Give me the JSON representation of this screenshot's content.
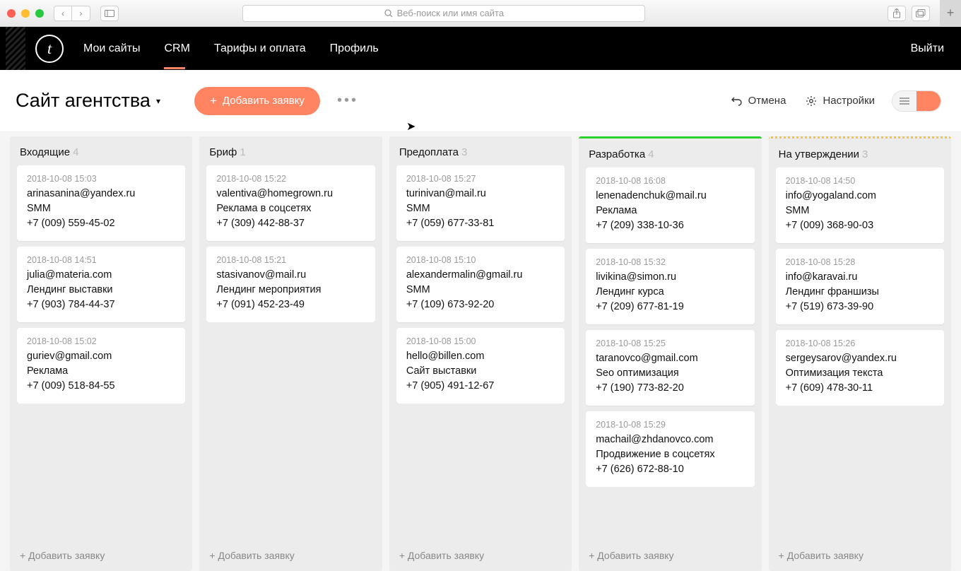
{
  "chrome": {
    "placeholder": "Веб-поиск или имя сайта"
  },
  "nav": {
    "logo": "t",
    "mySites": "Мои сайты",
    "crm": "CRM",
    "pricing": "Тарифы и оплата",
    "profile": "Профиль",
    "logout": "Выйти"
  },
  "toolbar": {
    "pageTitle": "Сайт агентства",
    "addLead": "Добавить заявку",
    "cancel": "Отмена",
    "settings": "Настройки"
  },
  "board": {
    "addCard": "+ Добавить заявку",
    "columns": [
      {
        "title": "Входящие",
        "count": "4",
        "accent": "none",
        "cards": [
          {
            "date": "2018-10-08 15:03",
            "email": "arinasanina@yandex.ru",
            "topic": "SMM",
            "phone": "+7 (009) 559-45-02"
          },
          {
            "date": "2018-10-08 14:51",
            "email": "julia@materia.com",
            "topic": "Лендинг выставки",
            "phone": "+7 (903) 784-44-37"
          },
          {
            "date": "2018-10-08 15:02",
            "email": "guriev@gmail.com",
            "topic": "Реклама",
            "phone": "+7 (009) 518-84-55"
          }
        ]
      },
      {
        "title": "Бриф",
        "count": "1",
        "accent": "none",
        "cards": [
          {
            "date": "2018-10-08 15:22",
            "email": "valentiva@homegrown.ru",
            "topic": "Реклама в соцсетях",
            "phone": "+7 (309) 442-88-37"
          },
          {
            "date": "2018-10-08 15:21",
            "email": "stasivanov@mail.ru",
            "topic": "Лендинг мероприятия",
            "phone": "+7 (091) 452-23-49"
          }
        ]
      },
      {
        "title": "Предоплата",
        "count": "3",
        "accent": "none",
        "cards": [
          {
            "date": "2018-10-08 15:27",
            "email": "turinivan@mail.ru",
            "topic": "SMM",
            "phone": "+7 (059) 677-33-81"
          },
          {
            "date": "2018-10-08 15:10",
            "email": "alexandermalin@gmail.ru",
            "topic": "SMM",
            "phone": "+7 (109) 673-92-20"
          },
          {
            "date": "2018-10-08 15:00",
            "email": "hello@billen.com",
            "topic": "Сайт выставки",
            "phone": "+7 (905) 491-12-67"
          }
        ]
      },
      {
        "title": "Разработка",
        "count": "4",
        "accent": "green",
        "cards": [
          {
            "date": "2018-10-08 16:08",
            "email": "lenenadenchuk@mail.ru",
            "topic": "Реклама",
            "phone": "+7 (209) 338-10-36"
          },
          {
            "date": "2018-10-08 15:32",
            "email": "livikina@simon.ru",
            "topic": "Лендинг курса",
            "phone": "+7 (209) 677-81-19"
          },
          {
            "date": "2018-10-08 15:25",
            "email": "taranovco@gmail.com",
            "topic": "Seo оптимизация",
            "phone": "+7 (190) 773-82-20"
          },
          {
            "date": "2018-10-08 15:29",
            "email": "machail@zhdanovco.com",
            "topic": "Продвижение в соцсетях",
            "phone": "+7 (626) 672-88-10"
          }
        ]
      },
      {
        "title": "На утверждении",
        "count": "3",
        "accent": "yellow",
        "cards": [
          {
            "date": "2018-10-08 14:50",
            "email": "info@yogaland.com",
            "topic": "SMM",
            "phone": "+7 (009) 368-90-03"
          },
          {
            "date": "2018-10-08 15:28",
            "email": "info@karavai.ru",
            "topic": "Лендинг франшизы",
            "phone": "+7 (519) 673-39-90"
          },
          {
            "date": "2018-10-08 15:26",
            "email": "sergeysarov@yandex.ru",
            "topic": "Оптимизация текста",
            "phone": "+7 (609) 478-30-11"
          }
        ]
      }
    ]
  }
}
